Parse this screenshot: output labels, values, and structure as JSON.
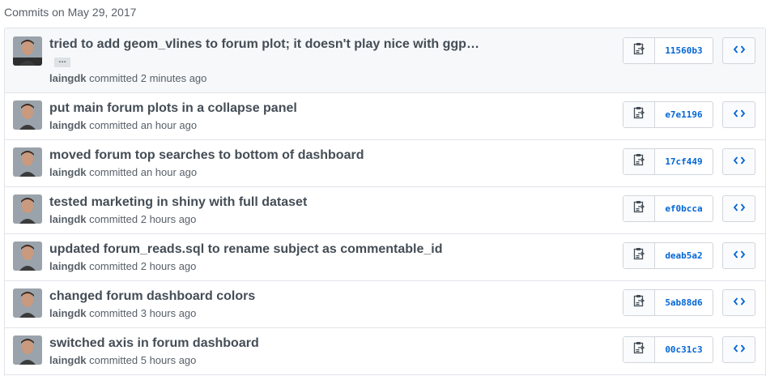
{
  "group_title": "Commits on May 29, 2017",
  "commits": [
    {
      "message": "tried to add geom_vlines to forum plot; it doesn't play nice with ggp…",
      "ellipsis": "…",
      "author": "laingdk",
      "verb": "committed",
      "time": "2 minutes ago",
      "sha": "11560b3",
      "expanded": true
    },
    {
      "message": "put main forum plots in a collapse panel",
      "author": "laingdk",
      "verb": "committed",
      "time": "an hour ago",
      "sha": "e7e1196"
    },
    {
      "message": "moved forum top searches to bottom of dashboard",
      "author": "laingdk",
      "verb": "committed",
      "time": "an hour ago",
      "sha": "17cf449"
    },
    {
      "message": "tested marketing in shiny with full dataset",
      "author": "laingdk",
      "verb": "committed",
      "time": "2 hours ago",
      "sha": "ef0bcca"
    },
    {
      "message": "updated forum_reads.sql to rename subject as commentable_id",
      "author": "laingdk",
      "verb": "committed",
      "time": "2 hours ago",
      "sha": "deab5a2"
    },
    {
      "message": "changed forum dashboard colors",
      "author": "laingdk",
      "verb": "committed",
      "time": "3 hours ago",
      "sha": "5ab88d6"
    },
    {
      "message": "switched axis in forum dashboard",
      "author": "laingdk",
      "verb": "committed",
      "time": "5 hours ago",
      "sha": "00c31c3"
    }
  ],
  "icons": {
    "copy": "clipboard-icon",
    "browse": "code-icon"
  },
  "colors": {
    "link": "#0366d6",
    "border": "#e1e4e8",
    "expanded_bg": "#f6f8fa"
  }
}
